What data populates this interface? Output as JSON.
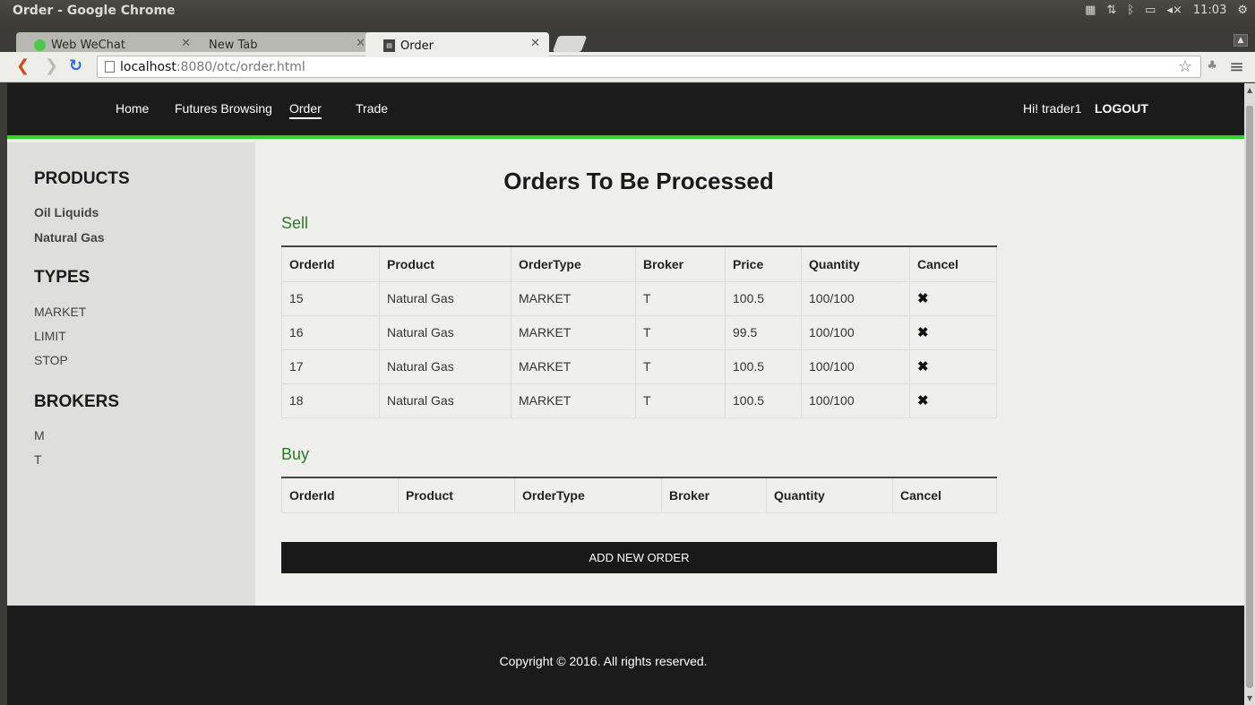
{
  "os": {
    "window_title": "Order - Google Chrome",
    "clock": "11:03"
  },
  "browser": {
    "tabs": [
      {
        "label": "Web WeChat"
      },
      {
        "label": "New Tab"
      },
      {
        "label": "Order"
      }
    ],
    "url_host": "localhost",
    "url_path": ":8080/otc/order.html"
  },
  "nav": {
    "home": "Home",
    "futures": "Futures Browsing",
    "order": "Order",
    "trade": "Trade",
    "greeting": "Hi! trader1",
    "logout": "LOGOUT"
  },
  "sidebar": {
    "products_heading": "PRODUCTS",
    "products": [
      "Oil Liquids",
      "Natural Gas"
    ],
    "types_heading": "TYPES",
    "types": [
      "MARKET",
      "LIMIT",
      "STOP"
    ],
    "brokers_heading": "BROKERS",
    "brokers": [
      "M",
      "T"
    ]
  },
  "main": {
    "title": "Orders To Be Processed",
    "sell_title": "Sell",
    "sell_columns": [
      "OrderId",
      "Product",
      "OrderType",
      "Broker",
      "Price",
      "Quantity",
      "Cancel"
    ],
    "sell_rows": [
      [
        "15",
        "Natural Gas",
        "MARKET",
        "T",
        "100.5",
        "100/100"
      ],
      [
        "16",
        "Natural Gas",
        "MARKET",
        "T",
        "99.5",
        "100/100"
      ],
      [
        "17",
        "Natural Gas",
        "MARKET",
        "T",
        "100.5",
        "100/100"
      ],
      [
        "18",
        "Natural Gas",
        "MARKET",
        "T",
        "100.5",
        "100/100"
      ]
    ],
    "cancel_glyph": "✖",
    "buy_title": "Buy",
    "buy_columns": [
      "OrderId",
      "Product",
      "OrderType",
      "Broker",
      "Quantity",
      "Cancel"
    ],
    "add_button": "ADD NEW ORDER"
  },
  "footer": {
    "copyright": "Copyright © 2016. All rights reserved."
  },
  "colors": {
    "accent_green": "#2bd62b",
    "section_green": "#2a7b22",
    "dark": "#1b1b1b"
  }
}
